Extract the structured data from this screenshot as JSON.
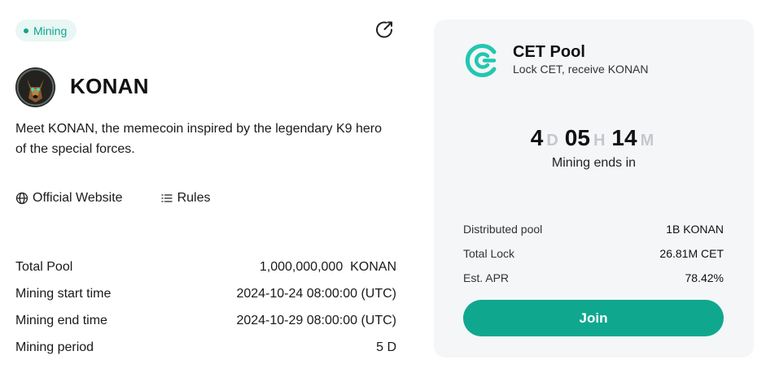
{
  "badge": {
    "label": "Mining"
  },
  "token": {
    "name": "KONAN",
    "description": "Meet KONAN, the memecoin inspired by the legendary K9 hero of the special forces."
  },
  "links": {
    "website": "Official Website",
    "rules": "Rules"
  },
  "info": [
    {
      "label": "Total Pool",
      "value": "1,000,000,000  KONAN"
    },
    {
      "label": "Mining start time",
      "value": "2024-10-24 08:00:00 (UTC)"
    },
    {
      "label": "Mining end time",
      "value": "2024-10-29 08:00:00 (UTC)"
    },
    {
      "label": "Mining period",
      "value": "5 D"
    }
  ],
  "pool": {
    "title": "CET Pool",
    "subtitle": "Lock CET, receive KONAN",
    "countdown": {
      "days": "4",
      "days_unit": "D",
      "hours": "05",
      "hours_unit": "H",
      "minutes": "14",
      "minutes_unit": "M"
    },
    "countdown_label": "Mining ends in",
    "stats": [
      {
        "label": "Distributed pool",
        "value": "1B KONAN"
      },
      {
        "label": "Total Lock",
        "value": "26.81M CET"
      },
      {
        "label": "Est. APR",
        "value": "78.42%"
      }
    ],
    "join_label": "Join"
  },
  "colors": {
    "accent": "#0fa88f",
    "badge_bg": "#e8f7f3",
    "card_bg": "#f5f6f7"
  },
  "icons": [
    "share-icon",
    "globe-icon",
    "list-icon",
    "coinex-logo"
  ]
}
